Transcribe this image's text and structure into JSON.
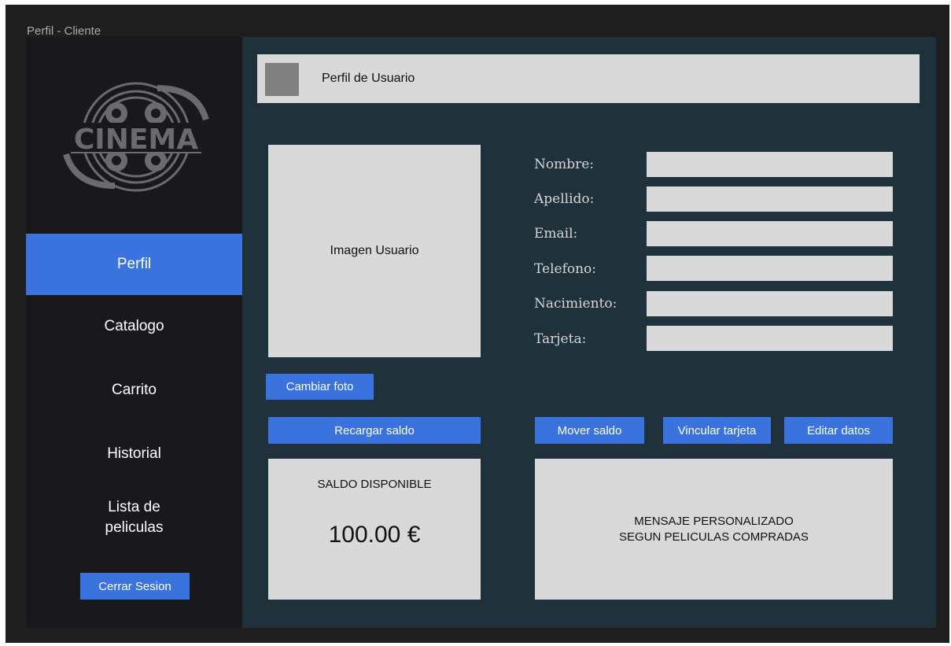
{
  "window": {
    "title": "Perfil - Cliente"
  },
  "sidebar": {
    "logo_text": "CINEMA",
    "items": [
      {
        "label": "Perfil",
        "active": true
      },
      {
        "label": "Catalogo",
        "active": false
      },
      {
        "label": "Carrito",
        "active": false
      },
      {
        "label": "Historial",
        "active": false
      },
      {
        "label_line1": "Lista de",
        "label_line2": "peliculas",
        "active": false
      }
    ],
    "logout_label": "Cerrar Sesion"
  },
  "header": {
    "title": "Perfil de Usuario"
  },
  "profile": {
    "image_label": "Imagen Usuario",
    "change_photo_label": "Cambiar foto"
  },
  "form": {
    "fields": [
      {
        "label": "Nombre:",
        "value": ""
      },
      {
        "label": "Apellido:",
        "value": ""
      },
      {
        "label": "Email:",
        "value": ""
      },
      {
        "label": "Telefono:",
        "value": ""
      },
      {
        "label": "Nacimiento:",
        "value": ""
      },
      {
        "label": "Tarjeta:",
        "value": ""
      }
    ]
  },
  "actions": {
    "recharge_label": "Recargar saldo",
    "move_label": "Mover saldo",
    "link_card_label": "Vincular tarjeta",
    "edit_label": "Editar datos"
  },
  "balance": {
    "label": "SALDO DISPONIBLE",
    "value": "100.00 €"
  },
  "message": {
    "line1": "MENSAJE PERSONALIZADO",
    "line2": "SEGUN PELICULAS COMPRADAS"
  },
  "colors": {
    "accent": "#3a73de",
    "sidebar_bg": "#18181d",
    "main_bg": "#1f313b",
    "panel_bg": "#d9d9d9"
  }
}
